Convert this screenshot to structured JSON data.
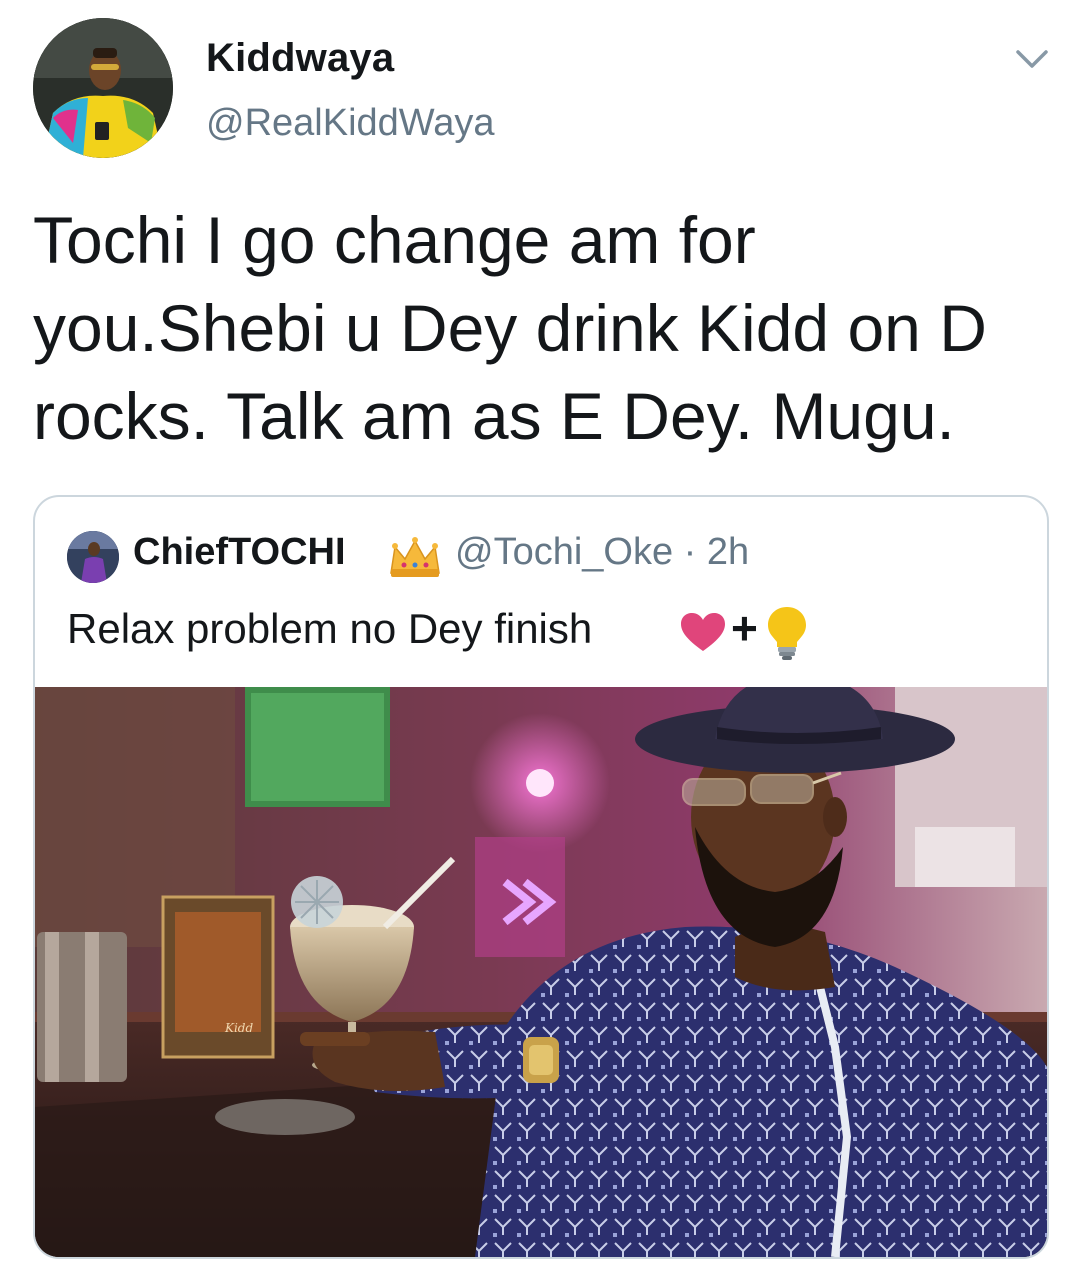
{
  "tweet": {
    "author": {
      "name": "Kiddwaya",
      "handle": "@RealKiddWaya"
    },
    "text_lines": [
      "Tochi I go change am for",
      "you.Shebi u Dey drink Kidd on D",
      "rocks. Talk am as E Dey. Mugu."
    ],
    "menu_icon": "chevron-down-icon"
  },
  "quote": {
    "author": {
      "name": "ChiefTOCHI",
      "badge_icon": "crown-emoji-icon",
      "handle_time": "@Tochi_Oke · 2h"
    },
    "text": "Relax problem no Dey finish",
    "emoji": {
      "heart_icon": "heart-emoji-icon",
      "plus": "+",
      "bulb_icon": "light-bulb-emoji-icon"
    },
    "media_icon": "photo-man-at-bar"
  },
  "colors": {
    "primary_text": "#14171a",
    "secondary_text": "#657786",
    "border": "#ccd6dd",
    "heart": "#e0457b",
    "bulb": "#f5c518"
  }
}
